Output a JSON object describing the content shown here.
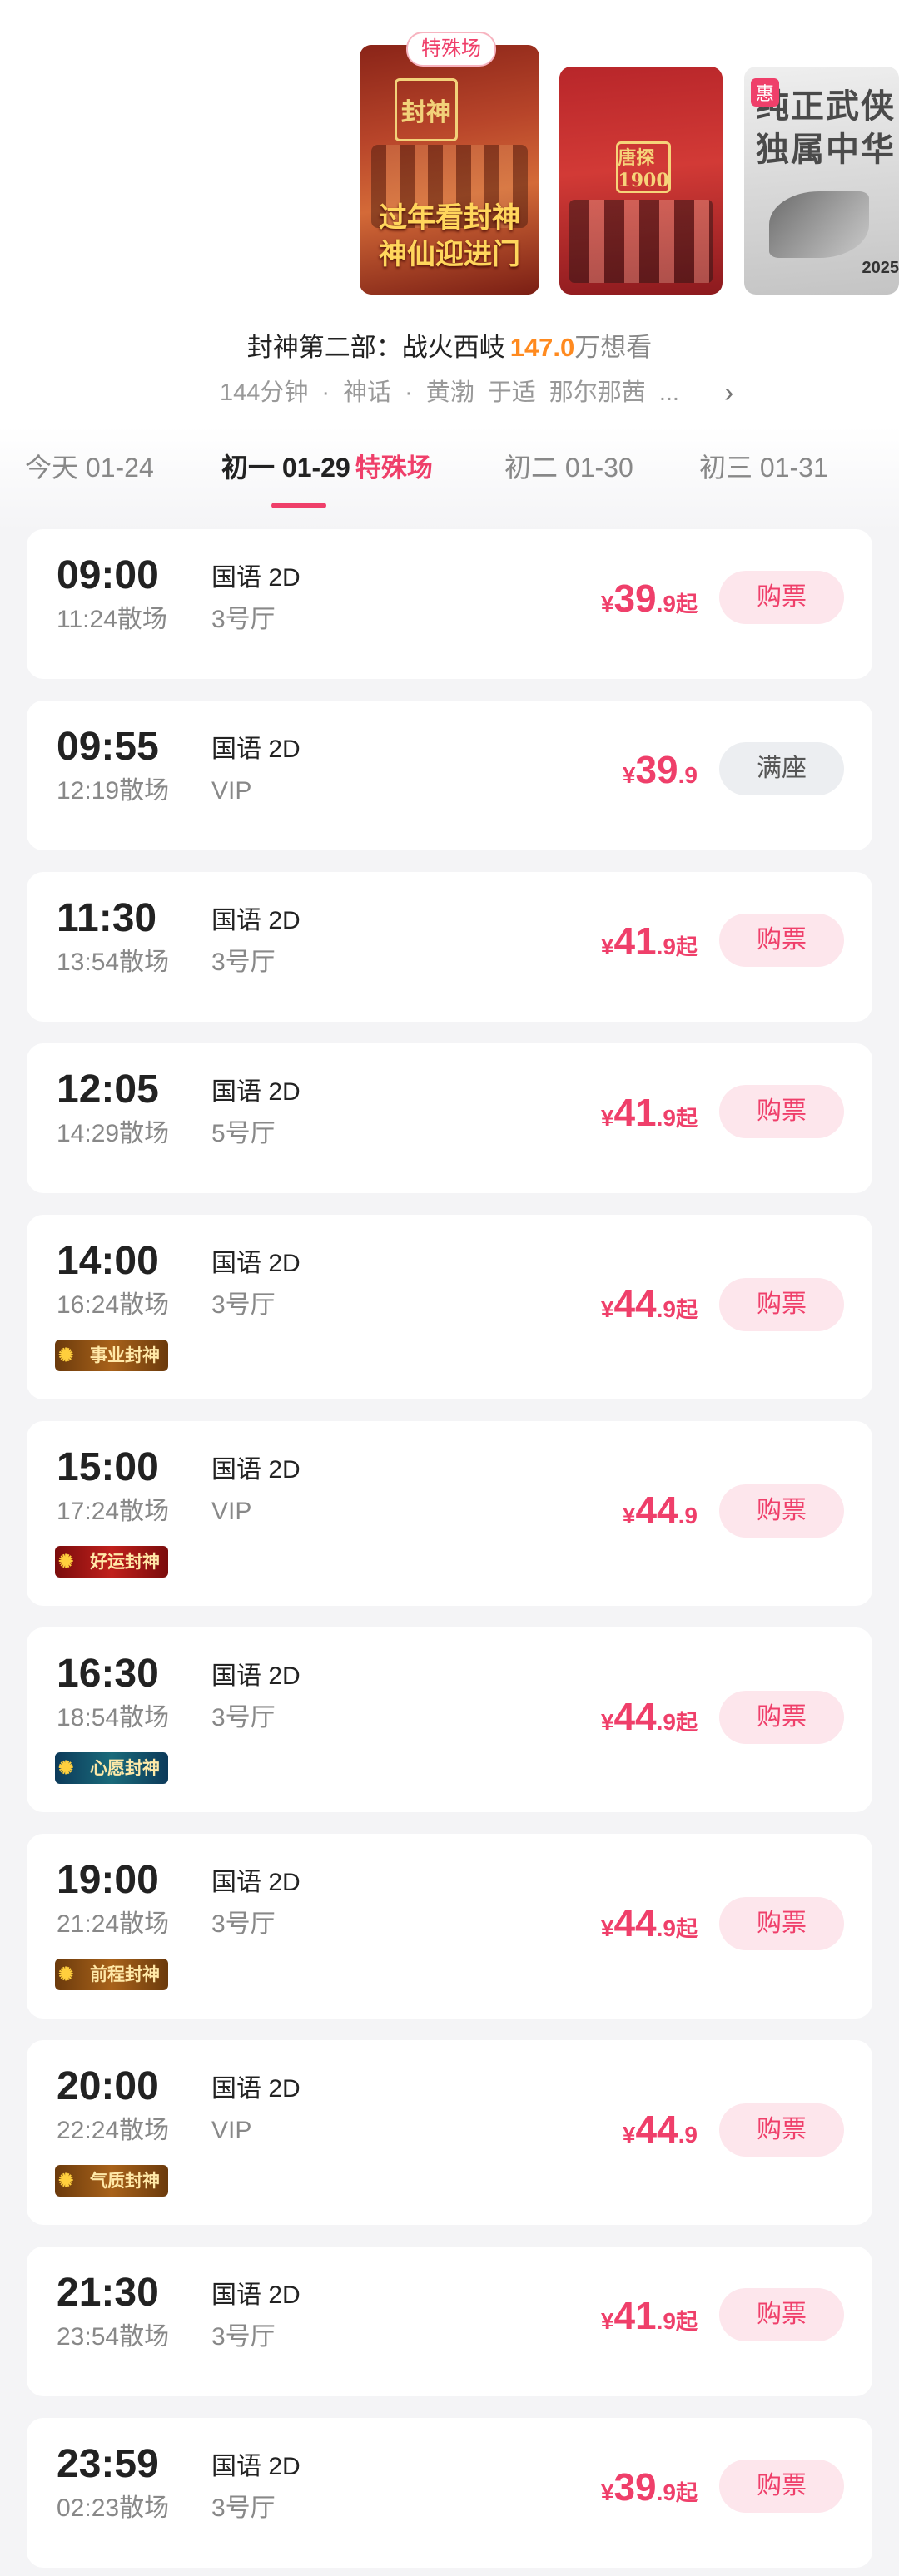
{
  "posters": [
    {
      "tag": "特殊场",
      "logo": "封神",
      "title_line1": "过年看封神",
      "title_line2": "神仙迎进门"
    },
    {
      "logo": "唐探1900"
    },
    {
      "badge": "惠",
      "text_line1": "纯正武侠",
      "text_line2": "独属中华",
      "year": "2025"
    }
  ],
  "movie": {
    "title": "封神第二部：战火西岐",
    "want_count": "147.0",
    "want_suffix": "万想看",
    "meta": [
      "144分钟",
      "·",
      "神话",
      "·",
      "黄渤",
      "于适",
      "那尔那茜",
      "..."
    ]
  },
  "date_tabs": [
    {
      "label": "今天 01-24"
    },
    {
      "label": "初一 01-29",
      "badge": "特殊场"
    },
    {
      "label": "初二 01-30"
    },
    {
      "label": "初三 01-31"
    }
  ],
  "showtimes": [
    {
      "start": "09:00",
      "end": "11:24散场",
      "lang": "国语 2D",
      "hall": "3号厅",
      "yen": "¥",
      "price_int": "39",
      "price_dec": ".9",
      "price_from": "起",
      "button": "购票"
    },
    {
      "start": "09:55",
      "end": "12:19散场",
      "lang": "国语 2D",
      "hall": "VIP",
      "yen": "¥",
      "price_int": "39",
      "price_dec": ".9",
      "price_from": "",
      "button": "满座"
    },
    {
      "start": "11:30",
      "end": "13:54散场",
      "lang": "国语 2D",
      "hall": "3号厅",
      "yen": "¥",
      "price_int": "41",
      "price_dec": ".9",
      "price_from": "起",
      "button": "购票"
    },
    {
      "start": "12:05",
      "end": "14:29散场",
      "lang": "国语 2D",
      "hall": "5号厅",
      "yen": "¥",
      "price_int": "41",
      "price_dec": ".9",
      "price_from": "起",
      "button": "购票"
    },
    {
      "start": "14:00",
      "end": "16:24散场",
      "lang": "国语 2D",
      "hall": "3号厅",
      "badge": "事业封神",
      "yen": "¥",
      "price_int": "44",
      "price_dec": ".9",
      "price_from": "起",
      "button": "购票"
    },
    {
      "start": "15:00",
      "end": "17:24散场",
      "lang": "国语 2D",
      "hall": "VIP",
      "badge": "好运封神",
      "yen": "¥",
      "price_int": "44",
      "price_dec": ".9",
      "price_from": "",
      "button": "购票"
    },
    {
      "start": "16:30",
      "end": "18:54散场",
      "lang": "国语 2D",
      "hall": "3号厅",
      "badge": "心愿封神",
      "yen": "¥",
      "price_int": "44",
      "price_dec": ".9",
      "price_from": "起",
      "button": "购票"
    },
    {
      "start": "19:00",
      "end": "21:24散场",
      "lang": "国语 2D",
      "hall": "3号厅",
      "badge": "前程封神",
      "yen": "¥",
      "price_int": "44",
      "price_dec": ".9",
      "price_from": "起",
      "button": "购票"
    },
    {
      "start": "20:00",
      "end": "22:24散场",
      "lang": "国语 2D",
      "hall": "VIP",
      "badge": "气质封神",
      "yen": "¥",
      "price_int": "44",
      "price_dec": ".9",
      "price_from": "",
      "button": "购票"
    },
    {
      "start": "21:30",
      "end": "23:54散场",
      "lang": "国语 2D",
      "hall": "3号厅",
      "yen": "¥",
      "price_int": "41",
      "price_dec": ".9",
      "price_from": "起",
      "button": "购票"
    },
    {
      "start": "23:59",
      "end": "02:23散场",
      "lang": "国语 2D",
      "hall": "3号厅",
      "yen": "¥",
      "price_int": "39",
      "price_dec": ".9",
      "price_from": "起",
      "button": "购票"
    }
  ],
  "colors": {
    "accent": "#ef3f6a",
    "want_count": "#ff8a1f",
    "button_bg": "#fde6ec",
    "full_button_bg": "#eceef1"
  }
}
